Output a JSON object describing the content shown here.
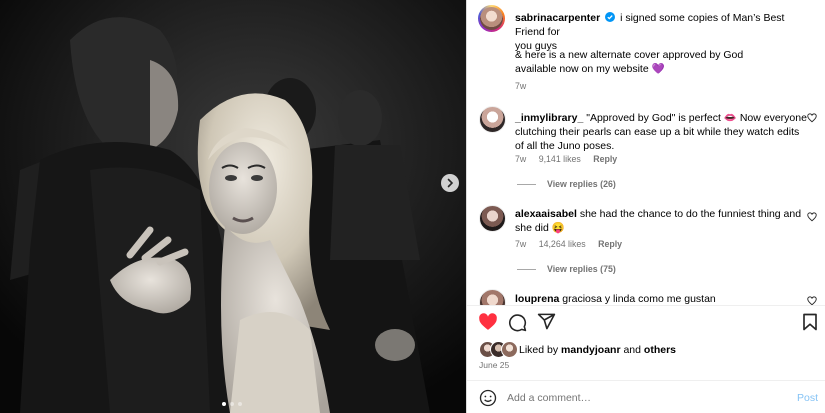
{
  "post": {
    "username": "sabrinacarpenter",
    "caption_line1": "i signed some copies of Man’s Best Friend for",
    "caption_line2": "you guys",
    "caption_line3": "& here is a new alternate cover approved by God",
    "caption_line4": "available now on my website 💜",
    "time": "7w",
    "verified": true
  },
  "comments": [
    {
      "username": "_inmylibrary_",
      "line1": "\"Approved by God\" is perfect 👄 Now everyone",
      "line2": "clutching their pearls can ease up a bit while they watch edits",
      "line3": "of all the Juno poses.",
      "time": "7w",
      "likes": "9,141 likes",
      "reply": "Reply",
      "view_replies": "View replies (26)"
    },
    {
      "username": "alexaaisabel",
      "line1": "she had the chance to do the funniest thing and",
      "line2": "she did 😝",
      "time": "7w",
      "likes": "14,264 likes",
      "reply": "Reply",
      "view_replies": "View replies (75)"
    },
    {
      "username": "louprena",
      "line1": "graciosa y linda como me gustan"
    }
  ],
  "liked_by": {
    "prefix": "Liked by",
    "user": "mandyjoanr",
    "and": "and",
    "others": "others"
  },
  "date": "June 25",
  "composer": {
    "placeholder": "Add a comment…",
    "post_label": "Post"
  },
  "carousel": {
    "current": 1,
    "total": 3
  },
  "colors": {
    "liked_heart": "#ff3040",
    "verified": "#0095f6",
    "post_button": "#85c3f5"
  }
}
